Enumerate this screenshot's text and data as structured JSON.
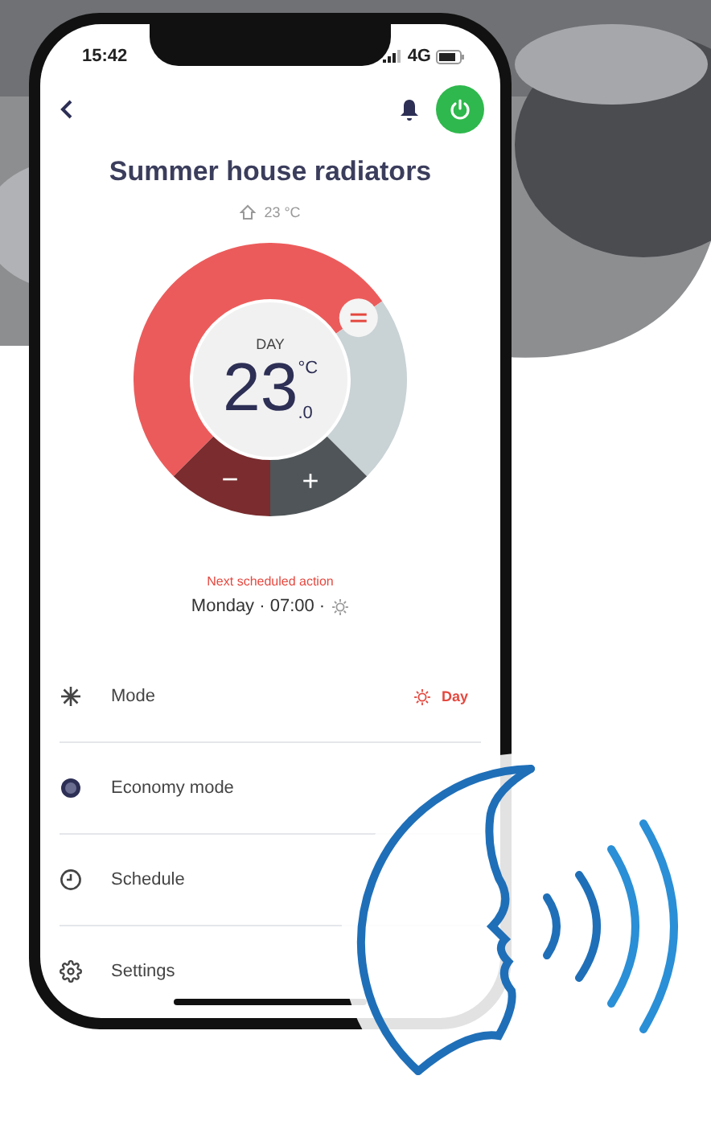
{
  "status_bar": {
    "time": "15:42",
    "network": "4G"
  },
  "header": {
    "power_on": true
  },
  "device": {
    "title": "Summer house radiators",
    "indoor_temperature": "23 °C"
  },
  "dial": {
    "period": "DAY",
    "temperature": "23",
    "unit": "°C",
    "decimal": ".0",
    "decrease": "−",
    "increase": "+"
  },
  "next_action": {
    "label": "Next scheduled action",
    "value": "Monday · 07:00 ·"
  },
  "settings": [
    {
      "kind": "mode",
      "label": "Mode",
      "value": "Day"
    },
    {
      "kind": "economy",
      "label": "Economy mode"
    },
    {
      "kind": "schedule",
      "label": "Schedule"
    },
    {
      "kind": "settings",
      "label": "Settings"
    }
  ]
}
